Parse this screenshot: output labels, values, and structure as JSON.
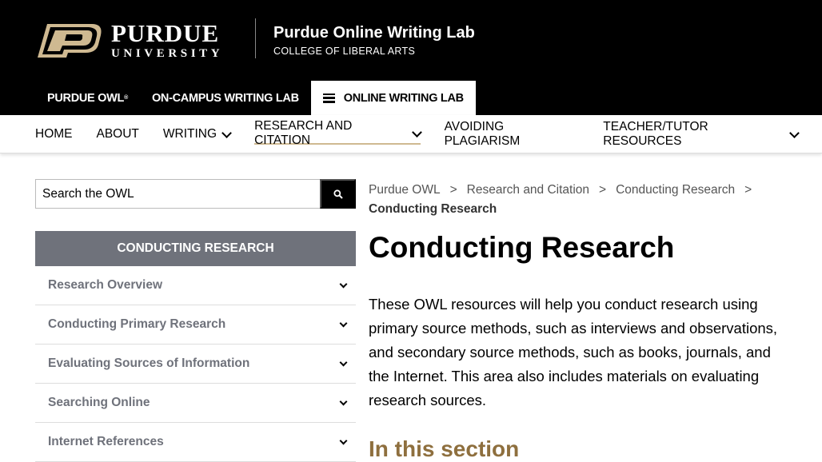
{
  "brand": {
    "logo_word1": "PURDUE",
    "logo_word2": "UNIVERSITY",
    "site_title": "Purdue Online Writing Lab",
    "site_subtitle": "COLLEGE OF LIBERAL ARTS",
    "accent_color": "#cfb991"
  },
  "tabs": [
    {
      "label": "PURDUE OWL",
      "mark": "®"
    },
    {
      "label": "ON-CAMPUS WRITING LAB"
    },
    {
      "label": "ONLINE WRITING LAB",
      "icon": "hamburger-menu-icon"
    }
  ],
  "nav": {
    "items": [
      "HOME",
      "ABOUT",
      "WRITING",
      "RESEARCH AND CITATION",
      "AVOIDING PLAGIARISM",
      "TEACHER/TUTOR RESOURCES"
    ]
  },
  "search": {
    "placeholder": "Search the OWL",
    "icon": "search-icon"
  },
  "sidebar": {
    "header": "CONDUCTING RESEARCH",
    "items": [
      "Research Overview",
      "Conducting Primary Research",
      "Evaluating Sources of Information",
      "Searching Online",
      "Internet References"
    ]
  },
  "breadcrumb": {
    "items": [
      "Purdue OWL",
      "Research and Citation",
      "Conducting Research"
    ],
    "separator": ">",
    "current": "Conducting Research"
  },
  "content": {
    "title": "Conducting Research",
    "intro": "These OWL resources will help you conduct research using primary source methods, such as interviews and observations, and secondary source methods, such as books, journals, and the Internet. This area also includes materials on evaluating research sources.",
    "section_heading": "In this section"
  }
}
